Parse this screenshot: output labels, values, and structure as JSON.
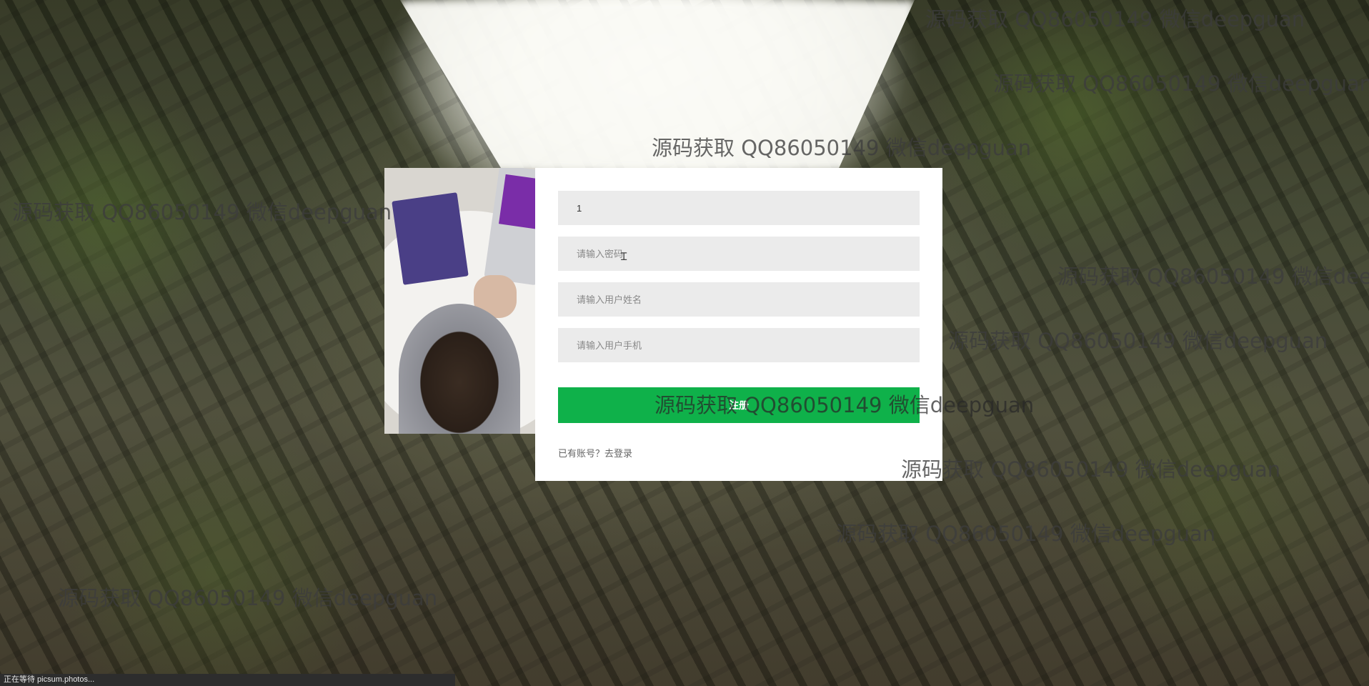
{
  "form": {
    "username_value": "1",
    "password_placeholder": "请输入密码",
    "realname_placeholder": "请输入用户姓名",
    "phone_placeholder": "请输入用户手机",
    "submit_label": "注册",
    "login_link": "已有账号？去登录"
  },
  "watermarks": [
    "源码获取 QQ86050149 微信deepguan",
    "源码获取 QQ86050149 微信deepguan",
    "源码获取 QQ86050149 微信deepguan",
    "源码获取 QQ86050149 微信deepguan",
    "源码获取 QQ86050149 微信dee",
    "源码获取 QQ86050149 微信deepguan",
    "源码获取 QQ86050149 微信deepguan",
    "源码获取 QQ86050149 微信deepguan",
    "源码获取 QQ86050149 微信deepguan",
    "源码获取 QQ86050149 微信deepguan"
  ],
  "status_bar": {
    "text": "正在等待 picsum.photos..."
  },
  "colors": {
    "submit_bg": "#0fb14a",
    "field_bg": "#ebebeb",
    "card_bg": "#ffffff"
  },
  "icons": {
    "cursor": "text-cursor-icon"
  }
}
